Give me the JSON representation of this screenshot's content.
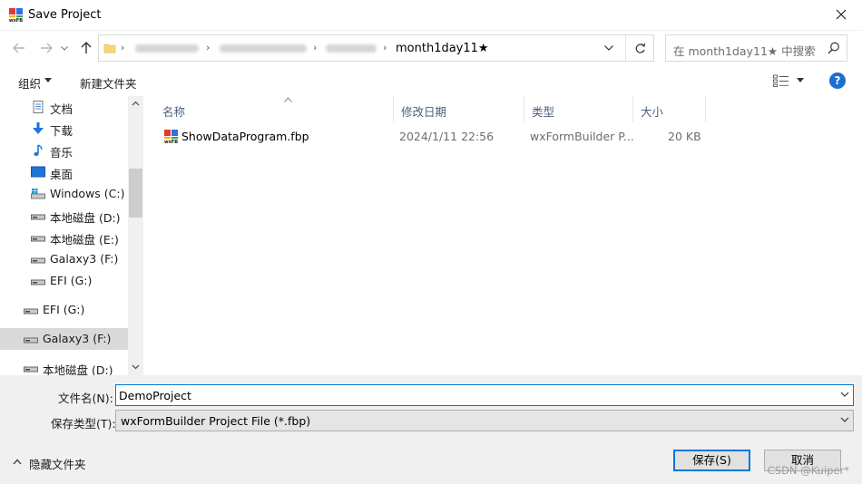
{
  "window": {
    "title": "Save Project"
  },
  "address": {
    "current_folder": "month1day11★",
    "search_placeholder": "在 month1day11★ 中搜索"
  },
  "toolbar": {
    "organize": "组织",
    "new_folder": "新建文件夹"
  },
  "nav": {
    "items": [
      {
        "label": "文档",
        "icon": "document-icon"
      },
      {
        "label": "下载",
        "icon": "download-icon"
      },
      {
        "label": "音乐",
        "icon": "music-icon"
      },
      {
        "label": "桌面",
        "icon": "desktop-icon"
      },
      {
        "label": "Windows (C:)",
        "icon": "windows-drive-icon"
      },
      {
        "label": "本地磁盘 (D:)",
        "icon": "drive-icon"
      },
      {
        "label": "本地磁盘 (E:)",
        "icon": "drive-icon"
      },
      {
        "label": "Galaxy3 (F:)",
        "icon": "drive-icon"
      },
      {
        "label": "EFI (G:)",
        "icon": "drive-icon"
      },
      {
        "label": "EFI (G:)",
        "icon": "drive-icon"
      },
      {
        "label": "Galaxy3 (F:)",
        "icon": "drive-icon"
      },
      {
        "label": "本地磁盘 (D:)",
        "icon": "drive-icon"
      }
    ]
  },
  "columns": {
    "name": "名称",
    "date": "修改日期",
    "type": "类型",
    "size": "大小"
  },
  "files": [
    {
      "name": "ShowDataProgram.fbp",
      "date": "2024/1/11 22:56",
      "type": "wxFormBuilder P...",
      "size": "20 KB"
    }
  ],
  "form": {
    "filename_label": "文件名(N):",
    "filename_value": "DemoProject",
    "filetype_label": "保存类型(T):",
    "filetype_value": "wxFormBuilder Project File (*.fbp)"
  },
  "footer": {
    "hide_folders": "隐藏文件夹",
    "save": "保存(S)",
    "cancel": "取消",
    "watermark": "CSDN @Kuiper*"
  },
  "colors": {
    "accent": "#0078d7",
    "help": "#1a6fd1",
    "selected": "#d9d9d9"
  }
}
